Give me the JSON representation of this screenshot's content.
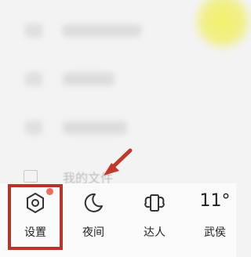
{
  "colors": {
    "highlight": "#b8332a",
    "badge": "#f26b5b",
    "background": "#f3f3f3"
  },
  "file_item": {
    "label": "我的文件"
  },
  "bottom_bar": {
    "settings": {
      "label": "设置",
      "icon": "settings-hexagon-icon",
      "has_badge": true
    },
    "night": {
      "label": "夜间",
      "icon": "moon-icon"
    },
    "expert": {
      "label": "达人",
      "icon": "winged-phone-icon"
    },
    "weather": {
      "value": "11°",
      "label": "武侯"
    }
  }
}
